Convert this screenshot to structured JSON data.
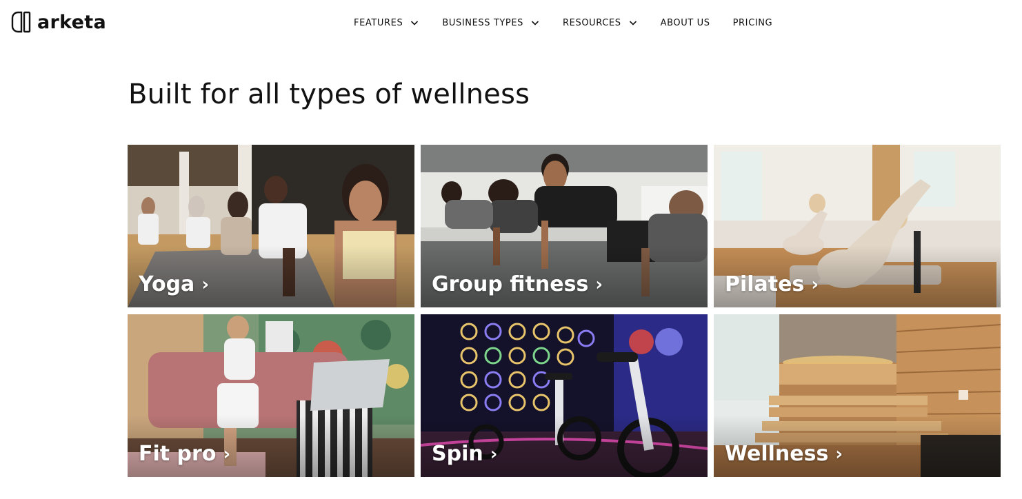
{
  "brand": {
    "name": "arketa"
  },
  "nav": {
    "items": [
      {
        "label": "FEATURES",
        "has_dropdown": true
      },
      {
        "label": "BUSINESS TYPES",
        "has_dropdown": true
      },
      {
        "label": "RESOURCES",
        "has_dropdown": true
      },
      {
        "label": "ABOUT US",
        "has_dropdown": false
      },
      {
        "label": "PRICING",
        "has_dropdown": false
      }
    ]
  },
  "page": {
    "title": "Built for all types of wellness"
  },
  "cards": [
    {
      "label": "Yoga",
      "arrow": "›"
    },
    {
      "label": "Group fitness",
      "arrow": "›"
    },
    {
      "label": "Pilates",
      "arrow": "›"
    },
    {
      "label": "Fit pro",
      "arrow": "›"
    },
    {
      "label": "Spin",
      "arrow": "›"
    },
    {
      "label": "Wellness",
      "arrow": "›"
    }
  ],
  "icons": {
    "logo": "arketa-logo-icon",
    "dropdown": "chevron-down-icon"
  }
}
